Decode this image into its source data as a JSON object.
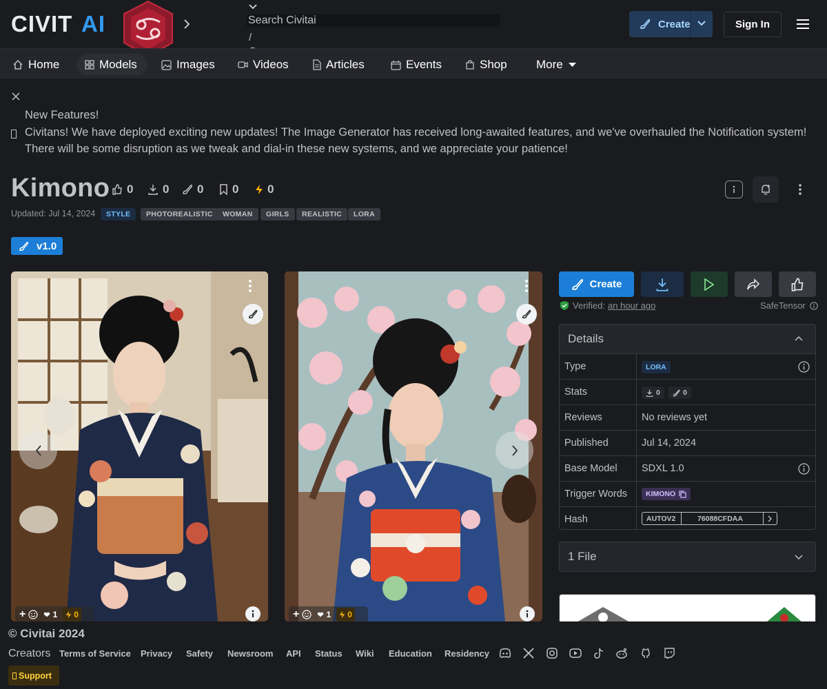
{
  "header": {
    "logo_text": "CIVITAI",
    "search_placeholder": "Search Civitai",
    "search_shortcut": "/",
    "create_label": "Create",
    "signin_label": "Sign In"
  },
  "nav": {
    "items": [
      {
        "label": "Home",
        "icon": "home-icon"
      },
      {
        "label": "Models",
        "icon": "grid-icon",
        "active": true
      },
      {
        "label": "Images",
        "icon": "image-icon"
      },
      {
        "label": "Videos",
        "icon": "video-icon"
      },
      {
        "label": "Articles",
        "icon": "file-icon"
      },
      {
        "label": "Events",
        "icon": "calendar-icon"
      },
      {
        "label": "Shop",
        "icon": "shopping-bag-icon"
      },
      {
        "label": "More",
        "icon": "caret-down-icon"
      }
    ]
  },
  "banner": {
    "title": "New Features!",
    "line1": "Civitans! We have deployed exciting new updates! The Image Generator has received long-awaited features, and we've overhauled the Notification system!",
    "line2": "There will be some disruption as we tweak and dial-in these new systems, and we appreciate your patience!"
  },
  "model": {
    "title": "Kimono",
    "stats": {
      "likes": "0",
      "downloads": "0",
      "generations": "0",
      "bookmarks": "0",
      "buzz": "0"
    },
    "updated": "Updated: Jul 14, 2024",
    "tags": [
      "STYLE",
      "PHOTOREALISTIC",
      "WOMAN",
      "GIRLS",
      "REALISTIC",
      "LORA"
    ],
    "version": "v1.0"
  },
  "gallery": {
    "cards": [
      {
        "hearts": "1",
        "buzz": "0"
      },
      {
        "hearts": "1",
        "buzz": "0"
      }
    ]
  },
  "actions": {
    "create_label": "Create",
    "verified_label": "Verified:",
    "verified_time": "an hour ago",
    "format": "SafeTensor"
  },
  "details": {
    "title": "Details",
    "rows": {
      "type_key": "Type",
      "type_val": "LORA",
      "stats_key": "Stats",
      "stats_downloads": "0",
      "stats_generations": "0",
      "reviews_key": "Reviews",
      "reviews_val": "No reviews yet",
      "published_key": "Published",
      "published_val": "Jul 14, 2024",
      "base_key": "Base Model",
      "base_val": "SDXL 1.0",
      "trigger_key": "Trigger Words",
      "trigger_val": "KIMONO",
      "hash_key": "Hash",
      "hash_type": "AUTOV2",
      "hash_val": "76088CFDAA"
    }
  },
  "files": {
    "label": "1 File"
  },
  "footer": {
    "copyright": "© Civitai 2024",
    "creators": "Creators",
    "links": [
      "Terms of Service",
      "Privacy",
      "Safety",
      "Newsroom",
      "API",
      "Status",
      "Wiki",
      "Education",
      "Residency"
    ],
    "support_label": "Support"
  },
  "colors": {
    "background": "#1a1b1e",
    "nav_background": "#25262b",
    "accent_blue": "#1c7ed6",
    "create_header_bg": "#233b5a",
    "support_yellow": "#ffd43b"
  }
}
